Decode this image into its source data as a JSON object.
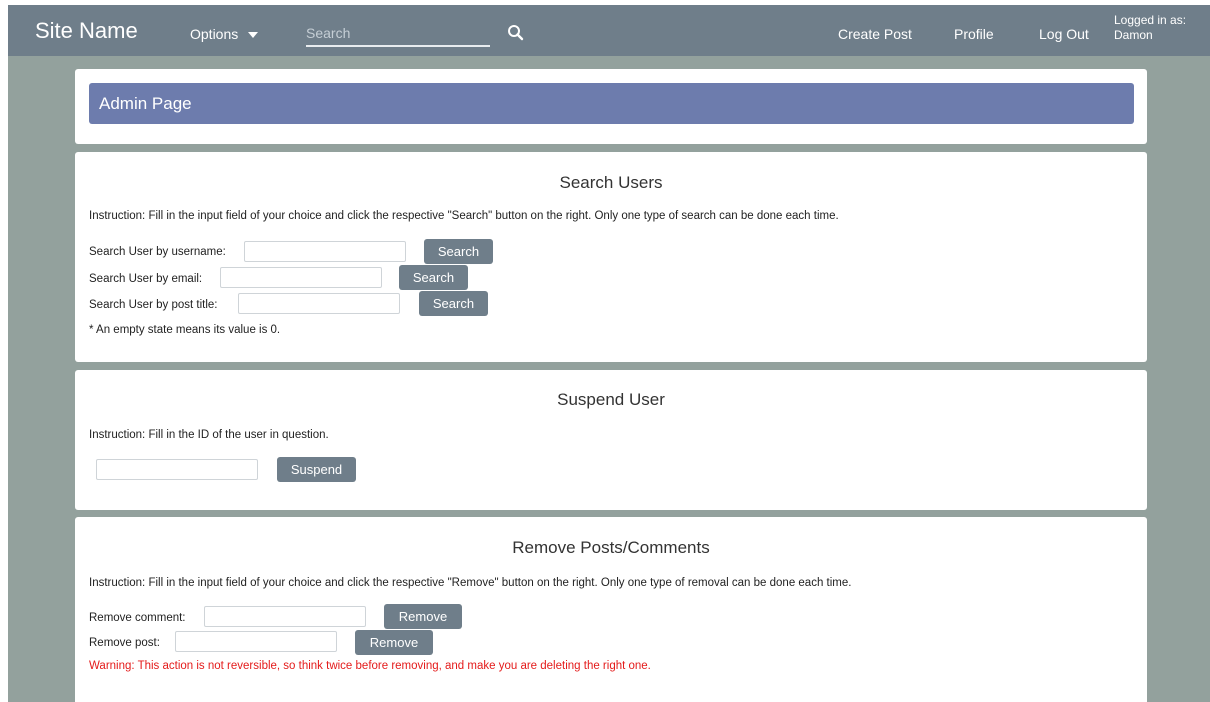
{
  "navbar": {
    "brand": "Site Name",
    "options_label": "Options",
    "search_placeholder": "Search",
    "create_post": "Create Post",
    "profile": "Profile",
    "logout": "Log Out",
    "logged_in_label": "Logged in as:",
    "username": "Damon"
  },
  "admin": {
    "title": "Admin Page"
  },
  "search_users": {
    "title": "Search Users",
    "instruction": "Instruction: Fill in the input field of your choice and click the respective \"Search\" button on the right. Only one type of search can be done each time.",
    "fields": [
      {
        "label": "Search User by username:",
        "button": "Search"
      },
      {
        "label": "Search User by email:",
        "button": "Search"
      },
      {
        "label": "Search User by post title:",
        "button": "Search"
      }
    ],
    "note": "* An empty state means its value is 0."
  },
  "suspend_user": {
    "title": "Suspend User",
    "instruction": "Instruction: Fill in the ID of the user in question.",
    "button": "Suspend"
  },
  "remove_posts": {
    "title": "Remove Posts/Comments",
    "instruction": "Instruction: Fill in the input field of your choice and click the respective \"Remove\" button on the right. Only one type of removal can be done each time.",
    "fields": [
      {
        "label": "Remove comment:",
        "button": "Remove"
      },
      {
        "label": "Remove post:",
        "button": "Remove"
      }
    ],
    "warning": "Warning: This action is not reversible, so think twice before removing, and make you are deleting the right one."
  },
  "colors": {
    "navbar": "#6f7e8a",
    "page_background": "#93a19d",
    "admin_banner": "#6d7cad",
    "button": "#6f7e8a",
    "warning_text": "#e41b1b"
  },
  "icons": {
    "search": "magnifier-icon",
    "options": "caret-down-icon"
  }
}
